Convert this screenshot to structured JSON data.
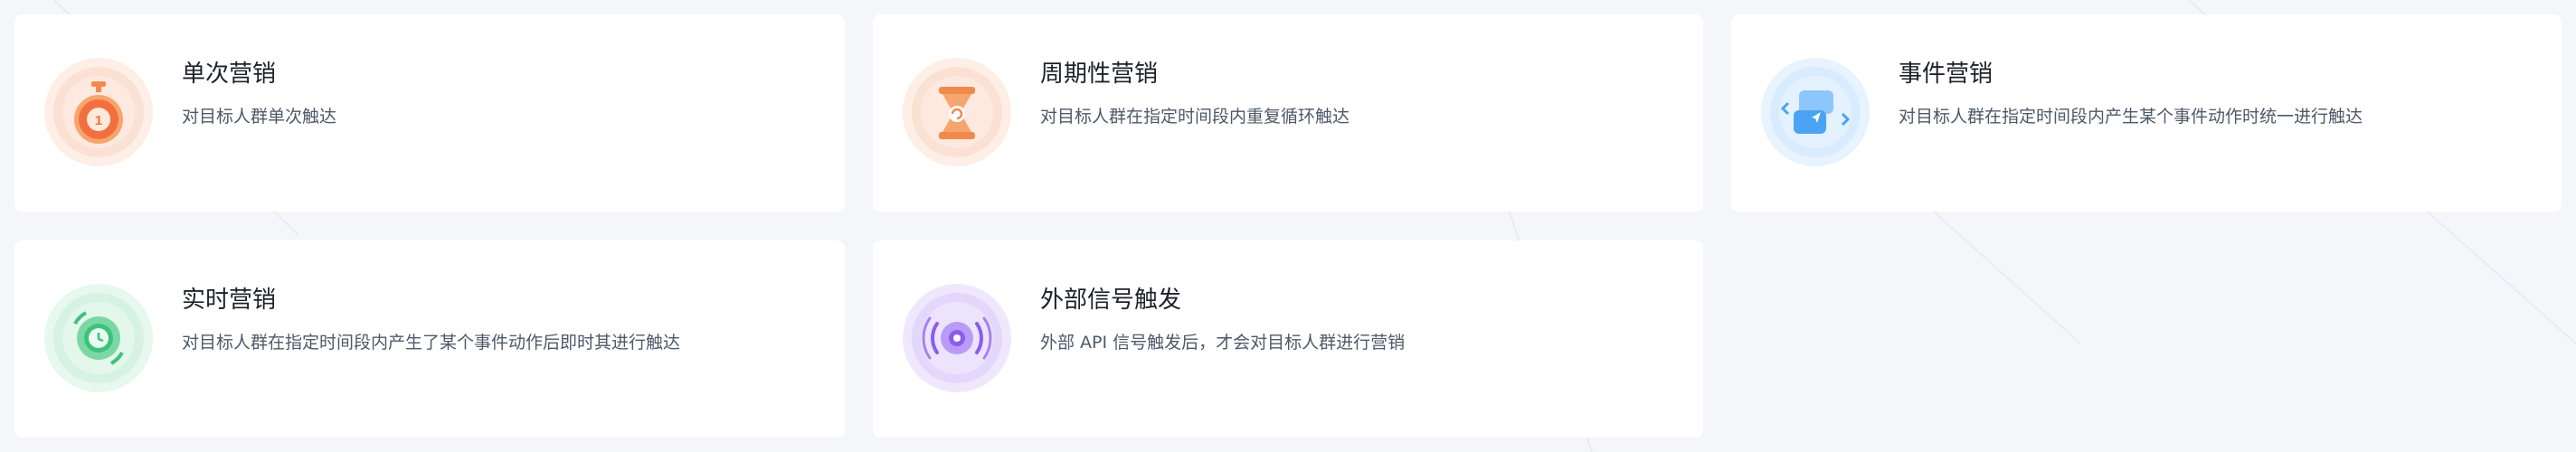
{
  "cards": [
    {
      "icon": "stopwatch-icon",
      "title": "单次营销",
      "desc": "对目标人群单次触达"
    },
    {
      "icon": "hourglass-cycle-icon",
      "title": "周期性营销",
      "desc": "对目标人群在指定时间段内重复循环触达"
    },
    {
      "icon": "event-chat-icon",
      "title": "事件营销",
      "desc": "对目标人群在指定时间段内产生某个事件动作时统一进行触达"
    },
    {
      "icon": "realtime-clock-icon",
      "title": "实时营销",
      "desc": "对目标人群在指定时间段内产生了某个事件动作后即时其进行触达"
    },
    {
      "icon": "signal-broadcast-icon",
      "title": "外部信号触发",
      "desc": "外部 API 信号触发后，才会对目标人群进行营销"
    }
  ],
  "colors": {
    "single": "#f26b3a",
    "periodic": "#f08a4b",
    "event": "#4aa3f5",
    "realtime": "#3ec27c",
    "external": "#8c5cf0"
  }
}
